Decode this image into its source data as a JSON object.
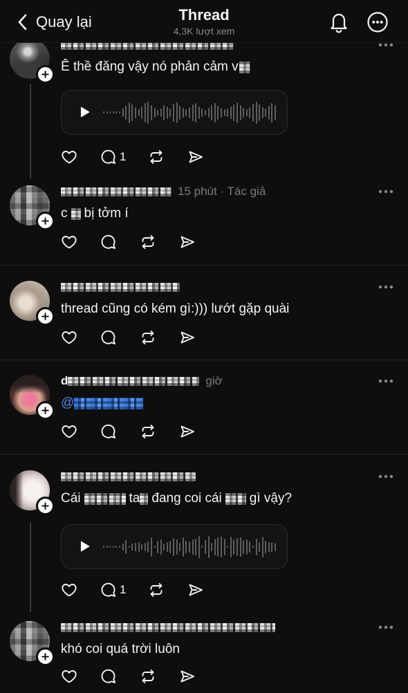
{
  "header": {
    "back_label": "Quay lại",
    "title": "Thread",
    "views": "4,3K lượt xem"
  },
  "icons": {
    "back": "chevron-left-icon",
    "notifications": "bell-icon",
    "more": "more-circle-icon",
    "reply_options": "more-horizontal-icon",
    "follow": "plus-icon",
    "like": "heart-icon",
    "reply": "comment-icon",
    "repost": "repost-icon",
    "share": "share-icon",
    "play": "play-icon"
  },
  "colors": {
    "background": "#0e0e0e",
    "text": "#f3f5f7",
    "secondary_text": "#7a7a7a",
    "divider": "#262626",
    "thread_line": "#3a3a3a",
    "mention": "#4a8ae8"
  },
  "replies": [
    {
      "text": [
        "Ê thề đăng vậy nó phản cảm v"
      ],
      "reply_count": "1"
    },
    {
      "meta": "15 phút · Tác giả",
      "text": [
        "c",
        "bị tởm í"
      ]
    },
    {
      "text": [
        "thread cũng có kém gì:))) lướt gặp quài"
      ]
    },
    {
      "username_start": "d",
      "meta": "giờ",
      "text": [
        "@"
      ]
    },
    {
      "text": [
        "Cái",
        "ta",
        "đang coi cái",
        "gì vậy?"
      ],
      "reply_count": "1"
    },
    {
      "text": [
        "khó coi quá trời luôn"
      ]
    }
  ]
}
